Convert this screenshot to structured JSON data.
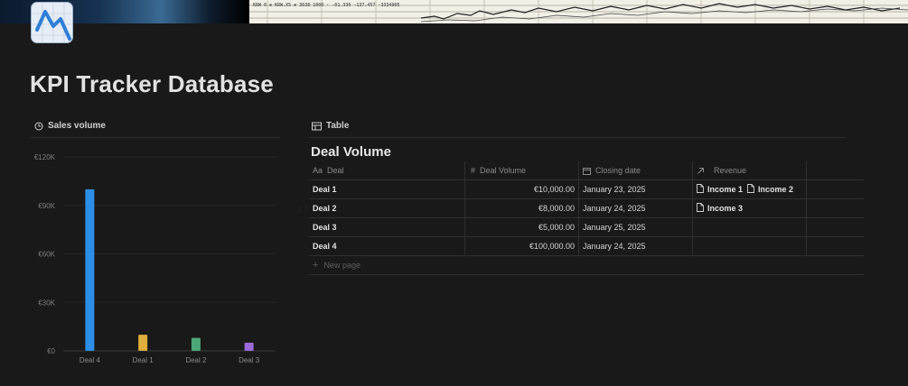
{
  "page": {
    "title": "KPI Tracker Database"
  },
  "cover": {
    "ticker_text": "KRW 0 ⊕ KRW.X5 ⊕  3038 1000  ·  -01.330  -137.457  -3334905"
  },
  "views": {
    "chart_tab": {
      "label": "Sales volume",
      "icon": "chart-clock-icon"
    },
    "table_tab": {
      "label": "Table",
      "icon": "table-icon"
    }
  },
  "chart_data": {
    "type": "bar",
    "categories": [
      "Deal 4",
      "Deal 1",
      "Deal 2",
      "Deal 3"
    ],
    "values": [
      100000,
      10000,
      8000,
      5000
    ],
    "colors": [
      "#2c8ee6",
      "#dfae3b",
      "#4da877",
      "#9a6bd8"
    ],
    "ylim": [
      0,
      120000
    ],
    "yticks": [
      0,
      30000,
      60000,
      90000,
      120000
    ],
    "ytick_labels": [
      "€0",
      "€30K",
      "€60K",
      "€90K",
      "€120K"
    ],
    "title": "",
    "xlabel": "",
    "ylabel": ""
  },
  "table": {
    "title": "Deal Volume",
    "columns": [
      {
        "label": "Deal",
        "icon": "Aa"
      },
      {
        "label": "Deal Volume",
        "icon": "#"
      },
      {
        "label": "Closing date",
        "icon": "calendar-icon"
      },
      {
        "label": "Revenue",
        "icon": "relation-arrow-icon"
      }
    ],
    "rows": [
      {
        "deal": "Deal 1",
        "volume": "€10,000.00",
        "date": "January 23, 2025",
        "revenue": [
          "Income 1",
          "Income 2"
        ]
      },
      {
        "deal": "Deal 2",
        "volume": "€8,000.00",
        "date": "January 24, 2025",
        "revenue": [
          "Income 3"
        ]
      },
      {
        "deal": "Deal 3",
        "volume": "€5,000.00",
        "date": "January 25, 2025",
        "revenue": []
      },
      {
        "deal": "Deal 4",
        "volume": "€100,000.00",
        "date": "January 24, 2025",
        "revenue": []
      }
    ],
    "new_page_label": "New page"
  }
}
